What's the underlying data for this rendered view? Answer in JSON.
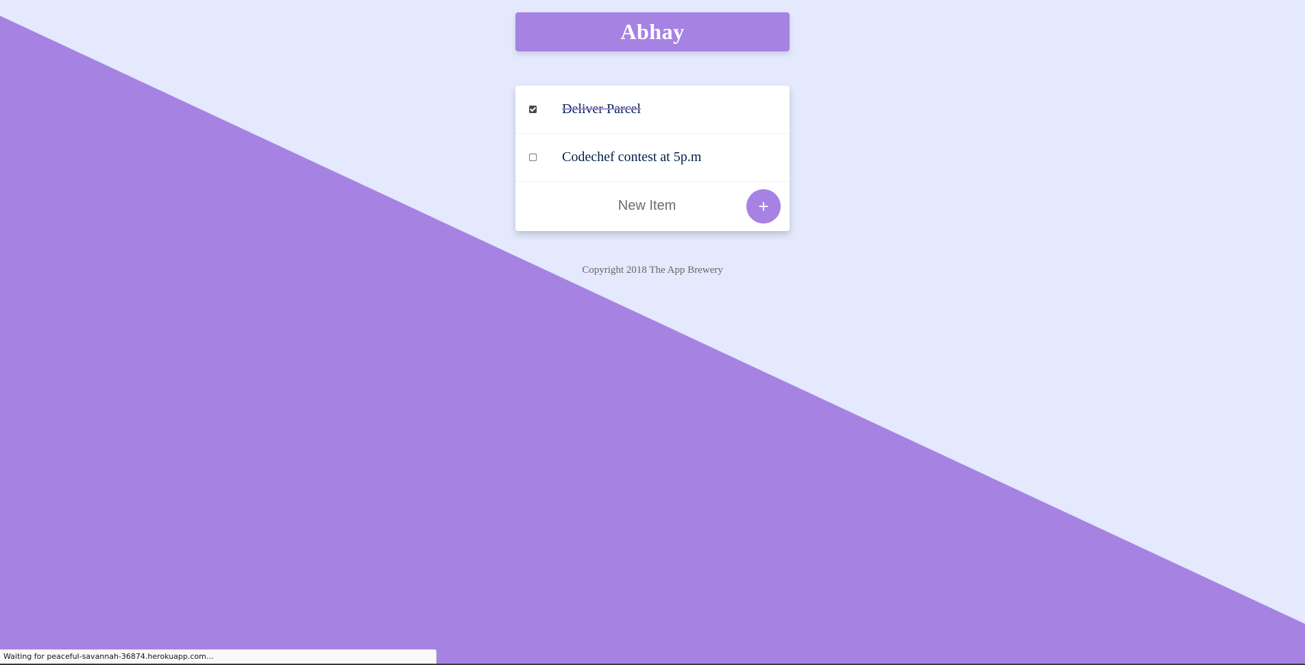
{
  "colors": {
    "background": "#E4E9FD",
    "accent": "#A683E3",
    "text": "#00204A"
  },
  "heading": {
    "title": "Abhay"
  },
  "todo": {
    "items": [
      {
        "label": "Deliver Parcel",
        "checked": true
      },
      {
        "label": "Codechef contest at 5p.m",
        "checked": false
      }
    ],
    "new_item": {
      "placeholder": "New Item",
      "value": "",
      "add_label": "+"
    }
  },
  "footer": {
    "text": "Copyright 2018 The App Brewery"
  },
  "status": {
    "text": "Waiting for peaceful-savannah-36874.herokuapp.com..."
  }
}
